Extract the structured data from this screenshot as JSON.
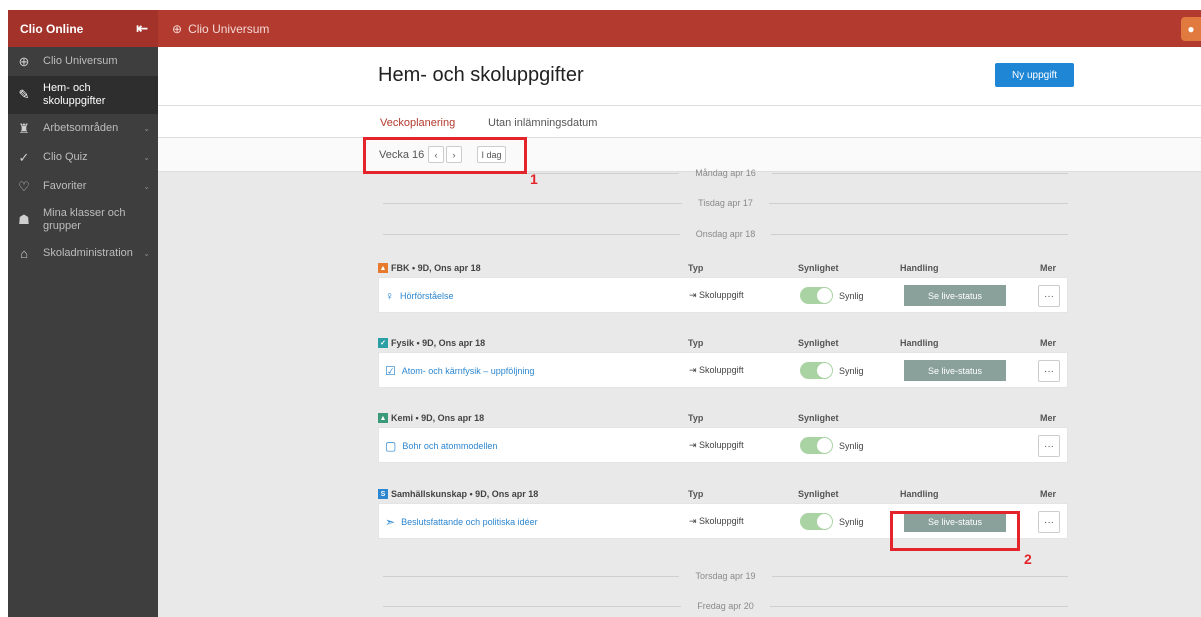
{
  "brand": {
    "title": "Clio Online",
    "collapse_icon": "collapse-menu-icon"
  },
  "topbar": {
    "breadcrumb": "Clio Universum",
    "globe_icon": "globe-icon",
    "avatar_icon": "user-icon",
    "colors": {
      "bar": "#b33a2e"
    }
  },
  "sidebar": {
    "items": [
      {
        "label": "Clio Universum",
        "icon": "globe-icon",
        "glyph": "⊕",
        "active": false,
        "expand": ""
      },
      {
        "label": "Hem- och skoluppgifter",
        "icon": "homework-icon",
        "glyph": "✎",
        "active": true,
        "expand": ""
      },
      {
        "label": "Arbetsområden",
        "icon": "binoculars-icon",
        "glyph": "♜",
        "active": false,
        "expand": "⌄"
      },
      {
        "label": "Clio Quiz",
        "icon": "check-icon",
        "glyph": "✓",
        "active": false,
        "expand": "⌄"
      },
      {
        "label": "Favoriter",
        "icon": "heart-icon",
        "glyph": "♡",
        "active": false,
        "expand": "⌄"
      },
      {
        "label": "Mina klasser och grupper",
        "icon": "group-icon",
        "glyph": "☗",
        "active": false,
        "expand": ""
      },
      {
        "label": "Skoladministration",
        "icon": "school-icon",
        "glyph": "⌂",
        "active": false,
        "expand": "⌄"
      }
    ]
  },
  "header": {
    "title": "Hem- och skoluppgifter",
    "new_button": "Ny uppgift",
    "accent": "#1f86d6"
  },
  "tabs": [
    {
      "label": "Veckoplanering",
      "active": true
    },
    {
      "label": "Utan inlämningsdatum",
      "active": false
    }
  ],
  "week": {
    "label": "Vecka 16",
    "prev": "‹",
    "next": "›",
    "today": "I dag"
  },
  "annotations": {
    "mark1": "1",
    "mark2": "2"
  },
  "days": {
    "mon": "Måndag apr 16",
    "tue": "Tisdag apr 17",
    "wed": "Onsdag apr 18",
    "thu": "Torsdag apr 19",
    "fri": "Fredag apr 20"
  },
  "columns": {
    "type": "Typ",
    "visibility": "Synlighet",
    "action": "Handling",
    "more": "Mer"
  },
  "groups": [
    {
      "subject": "FBK • 9D, Ons apr 18",
      "badge": "▲",
      "badge_color": "#e87a2e",
      "show_action": true,
      "task": {
        "name": "Hörförståelse",
        "icon": "lightbulb-icon",
        "glyph": "♀",
        "type": "Skoluppgift",
        "visibility": "Synlig",
        "live": "Se live-status",
        "more": "···"
      }
    },
    {
      "subject": "Fysik • 9D, Ons apr 18",
      "badge": "✓",
      "badge_color": "#2aa0a4",
      "show_action": true,
      "task": {
        "name": "Atom- och kärnfysik – uppföljning",
        "icon": "checkbox-icon",
        "glyph": "☑",
        "type": "Skoluppgift",
        "visibility": "Synlig",
        "live": "Se live-status",
        "more": "···"
      }
    },
    {
      "subject": "Kemi • 9D, Ons apr 18",
      "badge": "▲",
      "badge_color": "#3a9a7a",
      "show_action": false,
      "task": {
        "name": "Bohr och atommodellen",
        "icon": "document-icon",
        "glyph": "▢",
        "type": "Skoluppgift",
        "visibility": "Synlig",
        "live": "",
        "more": "···"
      }
    },
    {
      "subject": "Samhällskunskap • 9D, Ons apr 18",
      "badge": "S",
      "badge_color": "#2c86d0",
      "show_action": true,
      "task": {
        "name": "Beslutsfattande och politiska idéer",
        "icon": "megaphone-icon",
        "glyph": "➣",
        "type": "Skoluppgift",
        "visibility": "Synlig",
        "live": "Se live-status",
        "more": "···"
      }
    }
  ]
}
